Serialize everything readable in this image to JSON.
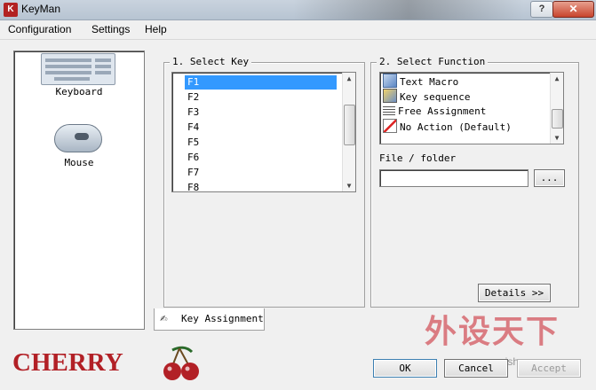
{
  "window": {
    "title": "KeyMan",
    "app_icon": "keyman-icon",
    "help_label": "?",
    "close_label": "✕"
  },
  "menu": [
    "Configuration",
    "Settings",
    "Help"
  ],
  "sidebar": {
    "items": [
      {
        "label": "Keyboard",
        "icon": "keyboard-icon"
      },
      {
        "label": "Mouse",
        "icon": "mouse-icon"
      }
    ]
  },
  "select_key": {
    "legend": "1. Select Key",
    "items": [
      "F1",
      "F2",
      "F3",
      "F4",
      "F5",
      "F6",
      "F7",
      "F8"
    ],
    "selected": "F1"
  },
  "select_function": {
    "legend": "2. Select Function",
    "items": [
      {
        "label": "Text Macro",
        "icon": "text-macro-icon"
      },
      {
        "label": "Key sequence",
        "icon": "key-sequence-icon"
      },
      {
        "label": "Free Assignment",
        "icon": "free-assignment-icon"
      },
      {
        "label": "No Action (Default)",
        "icon": "no-action-icon"
      }
    ],
    "file_label": "File / folder",
    "file_value": "",
    "browse_label": "...",
    "details_label": "Details >>"
  },
  "tab": {
    "label": "Key Assignment",
    "icon": "key-assignment-icon"
  },
  "buttons": {
    "ok": "OK",
    "cancel": "Cancel",
    "accept": "Accept"
  },
  "brand": {
    "logo_text": "CHERRY",
    "color": "#b22026"
  },
  "watermark": {
    "text": "外设天下",
    "url": "www.pcwaishe.cn"
  }
}
